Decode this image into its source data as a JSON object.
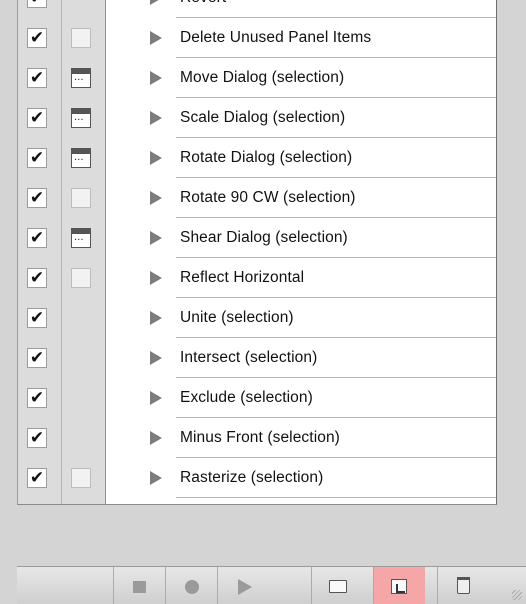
{
  "actions": [
    {
      "label": "Revert",
      "checked": true,
      "dialog": "none"
    },
    {
      "label": "Delete Unused Panel Items",
      "checked": true,
      "dialog": "off"
    },
    {
      "label": "Move Dialog (selection)",
      "checked": true,
      "dialog": "on"
    },
    {
      "label": "Scale Dialog (selection)",
      "checked": true,
      "dialog": "on"
    },
    {
      "label": "Rotate Dialog (selection)",
      "checked": true,
      "dialog": "on"
    },
    {
      "label": "Rotate 90 CW (selection)",
      "checked": true,
      "dialog": "off"
    },
    {
      "label": "Shear Dialog (selection)",
      "checked": true,
      "dialog": "on"
    },
    {
      "label": "Reflect Horizontal",
      "checked": true,
      "dialog": "off"
    },
    {
      "label": "Unite (selection)",
      "checked": true,
      "dialog": "none"
    },
    {
      "label": "Intersect (selection)",
      "checked": true,
      "dialog": "none"
    },
    {
      "label": "Exclude (selection)",
      "checked": true,
      "dialog": "none"
    },
    {
      "label": "Minus Front (selection)",
      "checked": true,
      "dialog": "none"
    },
    {
      "label": "Rasterize (selection)",
      "checked": true,
      "dialog": "off"
    }
  ],
  "toolbar": {
    "buttons": [
      "stop-recording",
      "begin-recording",
      "play-selection",
      "create-new-set",
      "create-new-action",
      "delete-selection"
    ],
    "highlighted": "create-new-action",
    "highlight_color": "#f5a6a6"
  },
  "check_glyph": "✔"
}
